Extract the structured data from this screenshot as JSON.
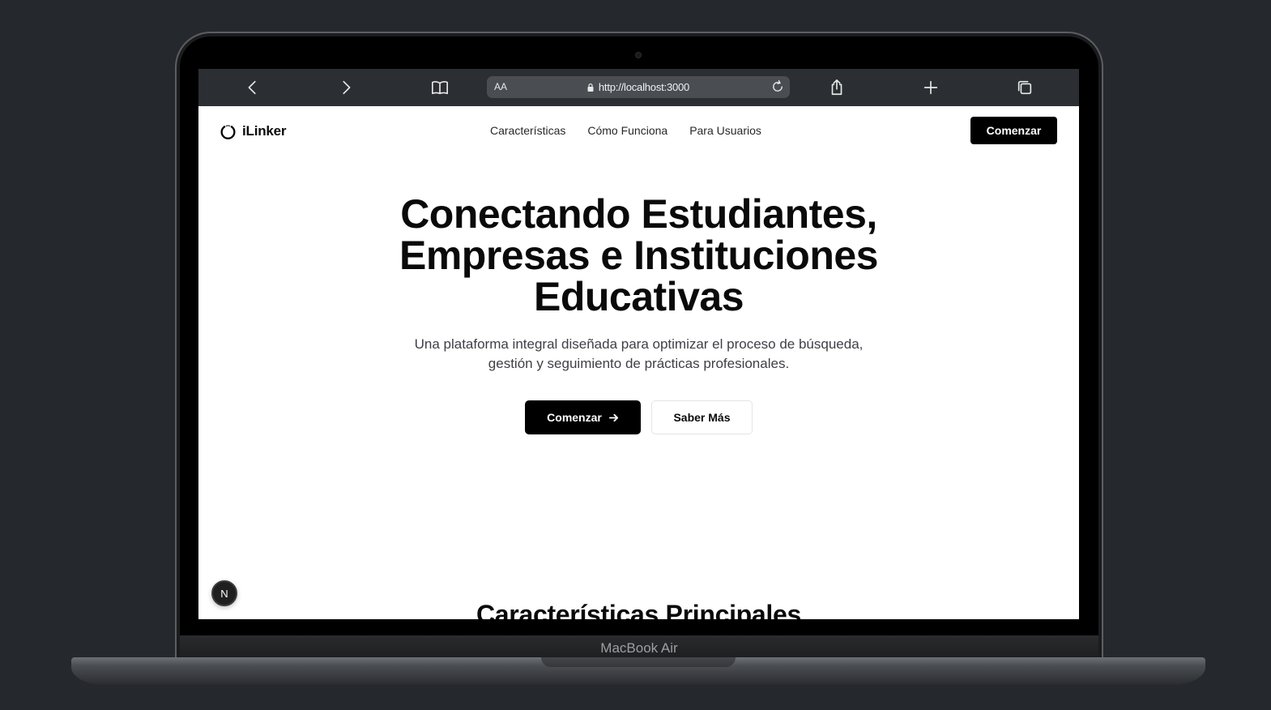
{
  "device": {
    "label": "MacBook Air"
  },
  "browser": {
    "text_size_label": "AA",
    "url": "http://localhost:3000",
    "icons": [
      "back-icon",
      "forward-icon",
      "bookmarks-icon",
      "lock-icon",
      "reload-icon",
      "share-icon",
      "new-tab-icon",
      "tabs-icon"
    ]
  },
  "header": {
    "brand": "iLinker",
    "nav": [
      "Características",
      "Cómo Funciona",
      "Para Usuarios"
    ],
    "cta_label": "Comenzar"
  },
  "hero": {
    "title_line1": "Conectando Estudiantes,",
    "title_line2": "Empresas e Instituciones",
    "title_line3": "Educativas",
    "subtitle_line1": "Una plataforma integral diseñada para optimizar el proceso de búsqueda,",
    "subtitle_line2": "gestión y seguimiento de prácticas profesionales.",
    "primary_label": "Comenzar",
    "secondary_label": "Saber Más"
  },
  "features": {
    "title": "Características Principales"
  },
  "dev_badge": {
    "letter": "N"
  },
  "colors": {
    "background": "#25292d",
    "primary": "#000000",
    "toolbar": "#2b2f33"
  }
}
